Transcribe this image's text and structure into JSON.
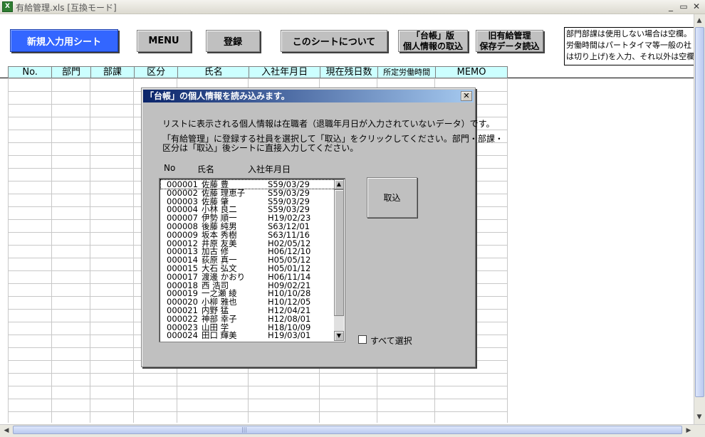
{
  "window": {
    "title": "有給管理.xls  [互換モード]",
    "app_icon": "X",
    "minimize": "_",
    "restore": "▭",
    "close": "✕"
  },
  "toolbar": {
    "new_sheet": "新規入力用シート",
    "menu": "MENU",
    "register": "登録",
    "about": "このシートについて",
    "ledger_line1": "「台帳」版",
    "ledger_line2": "個人情報の取込",
    "old_line1": "旧有給管理",
    "old_line2": "保存データ読込"
  },
  "note": {
    "lines": [
      "部門部課は使用しない場合は空欄。",
      "労働時間はパートタイマ等一般の社",
      "は切り上げ)を入力、それ以外は空欄"
    ]
  },
  "sheet": {
    "headers": [
      "No.",
      "部門",
      "部課",
      "区分",
      "氏名",
      "入社年月日",
      "現在残日数",
      "所定労働時間",
      "MEMO"
    ]
  },
  "dialog": {
    "title": "「台帳」の個人情報を読み込みます。",
    "close": "✕",
    "message1": "リストに表示される個人情報は在職者（退職年月日が入力されていないデータ）です。",
    "message2": "「有給管理」に登録する社員を選択して「取込」をクリックしてください。部門・部課・",
    "message3": "区分は「取込」後シートに直接入力してください。",
    "col_no": "No",
    "col_name": "氏名",
    "col_date": "入社年月日",
    "import_button": "取込",
    "select_all": "すべて選択",
    "employees": [
      {
        "no": "000001",
        "name": "佐藤 豊",
        "date": "S59/03/29"
      },
      {
        "no": "000002",
        "name": "佐藤 理恵子",
        "date": "S59/03/29"
      },
      {
        "no": "000003",
        "name": "佐藤 肇",
        "date": "S59/03/29"
      },
      {
        "no": "000004",
        "name": "小林 良二",
        "date": "S59/03/29"
      },
      {
        "no": "000007",
        "name": "伊勢 順一",
        "date": "H19/02/23"
      },
      {
        "no": "000008",
        "name": "後藤 純男",
        "date": "S63/12/01"
      },
      {
        "no": "000009",
        "name": "坂本 秀樹",
        "date": "S63/11/16"
      },
      {
        "no": "000012",
        "name": "井原 友美",
        "date": "H02/05/12"
      },
      {
        "no": "000013",
        "name": "加古 修",
        "date": "H06/12/10"
      },
      {
        "no": "000014",
        "name": "荻原 真一",
        "date": "H05/05/12"
      },
      {
        "no": "000015",
        "name": "大石 弘文",
        "date": "H05/01/12"
      },
      {
        "no": "000017",
        "name": "渡邊 かおり",
        "date": "H06/11/14"
      },
      {
        "no": "000018",
        "name": "西 浩司",
        "date": "H09/02/21"
      },
      {
        "no": "000019",
        "name": "一之瀬 綾",
        "date": "H10/10/28"
      },
      {
        "no": "000020",
        "name": "小柳 雅也",
        "date": "H10/12/05"
      },
      {
        "no": "000021",
        "name": "内野 猛",
        "date": "H12/04/21"
      },
      {
        "no": "000022",
        "name": "神部 幸子",
        "date": "H12/08/01"
      },
      {
        "no": "000023",
        "name": "山田 学",
        "date": "H18/10/09"
      },
      {
        "no": "000024",
        "name": "田口 輝美",
        "date": "H19/03/01"
      }
    ]
  },
  "scroll": {
    "up": "▲",
    "down": "▼",
    "left": "◀",
    "right": "▶",
    "grip": "|||"
  }
}
